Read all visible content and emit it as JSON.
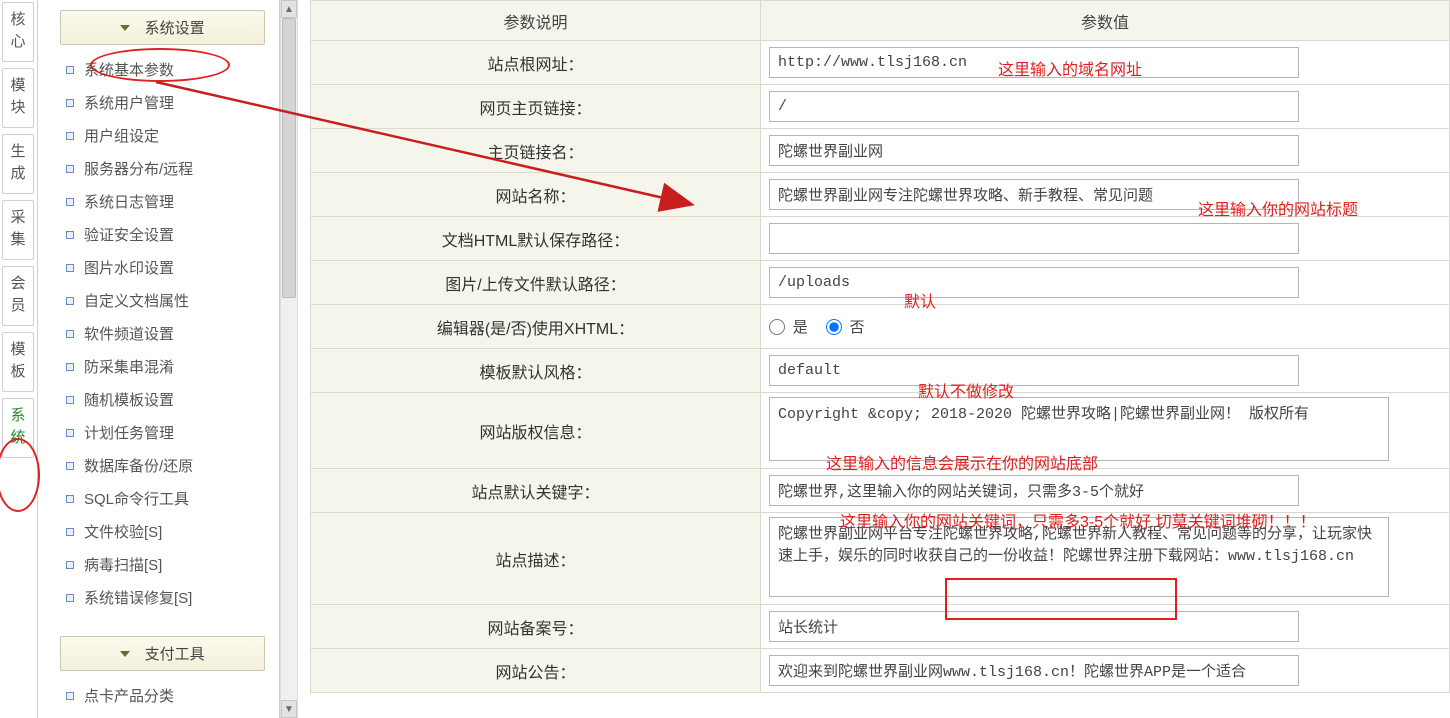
{
  "vtabs": [
    "核心",
    "模块",
    "生成",
    "采集",
    "会员",
    "模板",
    "系统"
  ],
  "vtab_active_index": 6,
  "sidebar": {
    "group1_title": "系统设置",
    "group2_title": "支付工具",
    "items1": [
      "系统基本参数",
      "系统用户管理",
      "用户组设定",
      "服务器分布/远程",
      "系统日志管理",
      "验证安全设置",
      "图片水印设置",
      "自定义文档属性",
      "软件频道设置",
      "防采集串混淆",
      "随机模板设置",
      "计划任务管理",
      "数据库备份/还原",
      "SQL命令行工具",
      "文件校验[S]",
      "病毒扫描[S]",
      "系统错误修复[S]"
    ],
    "items2": [
      "点卡产品分类"
    ]
  },
  "table": {
    "header_label": "参数说明",
    "header_value": "参数值",
    "rows": [
      {
        "label": "站点根网址：",
        "type": "text",
        "value": "http://www.tlsj168.cn"
      },
      {
        "label": "网页主页链接：",
        "type": "text",
        "value": "/"
      },
      {
        "label": "主页链接名：",
        "type": "text",
        "value": "陀螺世界副业网"
      },
      {
        "label": "网站名称：",
        "type": "text",
        "value": "陀螺世界副业网专注陀螺世界攻略、新手教程、常见问题"
      },
      {
        "label": "文档HTML默认保存路径：",
        "type": "text",
        "value": ""
      },
      {
        "label": "图片/上传文件默认路径：",
        "type": "text",
        "value": "/uploads"
      },
      {
        "label": "编辑器(是/否)使用XHTML：",
        "type": "radio",
        "yes": "是",
        "no": "否",
        "selected": "no"
      },
      {
        "label": "模板默认风格：",
        "type": "text",
        "value": "default"
      },
      {
        "label": "网站版权信息：",
        "type": "textarea",
        "value": "Copyright &copy; 2018-2020 陀螺世界攻略|陀螺世界副业网！ 版权所有"
      },
      {
        "label": "站点默认关键字：",
        "type": "text",
        "value": "陀螺世界,这里输入你的网站关键词，只需多3-5个就好"
      },
      {
        "label": "站点描述：",
        "type": "textarea",
        "value": "陀螺世界副业网平台专注陀螺世界攻略,陀螺世界新人教程、常见问题等的分享，让玩家快速上手，娱乐的同时收获自己的一份收益！陀螺世界注册下载网站：www.tlsj168.cn"
      },
      {
        "label": "网站备案号：",
        "type": "text",
        "value": "站长统计"
      },
      {
        "label": "网站公告：",
        "type": "text",
        "value": "欢迎来到陀螺世界副业网www.tlsj168.cn！陀螺世界APP是一个适合"
      }
    ]
  },
  "annotations": {
    "a1": "这里输入的域名网址",
    "a2": "这里输入你的网站标题",
    "a3": "默认",
    "a4": "默认不做修改",
    "a5": "这里输入的信息会展示在你的网站底部",
    "a6": "这里输入你的网站关键词，只需多3-5个就好  切莫关键词堆砌！！！",
    "circle_sidebar_item_index": 0
  }
}
